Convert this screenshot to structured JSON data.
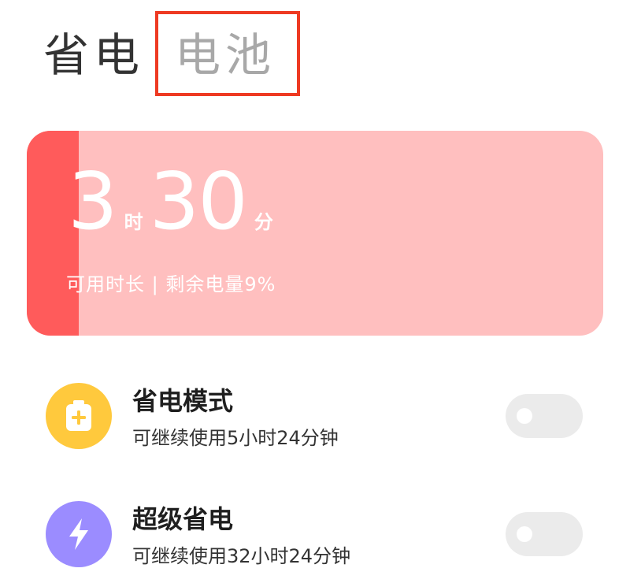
{
  "tabs": {
    "active_label": "省电",
    "inactive_label": "电池"
  },
  "battery": {
    "hours": "3",
    "hours_unit": "时",
    "minutes": "30",
    "minutes_unit": "分",
    "subtitle": "可用时长 | 剩余电量9%",
    "level_percent": 9,
    "fill_color": "#ff5b5b",
    "track_color": "#ffbfbf"
  },
  "modes": [
    {
      "title": "省电模式",
      "description": "可继续使用5小时24分钟",
      "icon": "battery-plus-icon",
      "icon_color": "#ffc93d",
      "enabled": false
    },
    {
      "title": "超级省电",
      "description": "可继续使用32小时24分钟",
      "icon": "lightning-icon",
      "icon_color": "#9b8cff",
      "enabled": false
    }
  ],
  "highlight_color": "#ee3a22"
}
